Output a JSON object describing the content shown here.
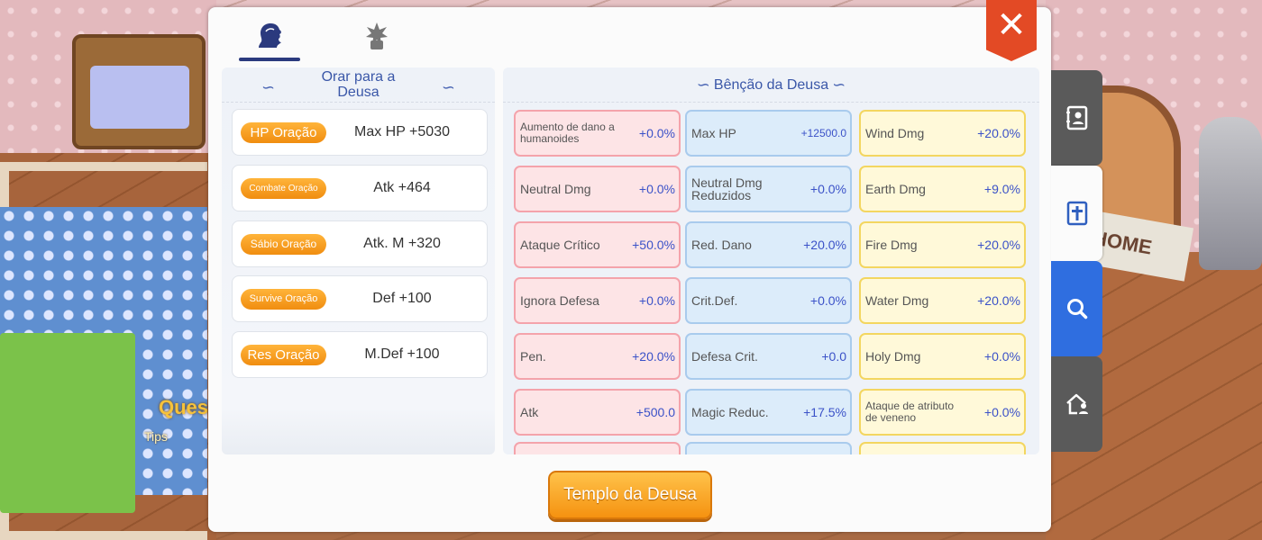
{
  "scene": {
    "quest_label": "Ques",
    "tips_label": "Tips",
    "home_sign": "HOME"
  },
  "tabs": [
    {
      "icon": "goddess-head-icon",
      "selected": true
    },
    {
      "icon": "emblem-icon",
      "selected": false
    }
  ],
  "close_icon": "close-icon",
  "close_glyph": "✕",
  "prayer_section": {
    "title": "Orar para a Deusa",
    "items": [
      {
        "button": "HP Oração",
        "value": "Max HP  +5030"
      },
      {
        "button": "Combate Oração",
        "value": "Atk +464"
      },
      {
        "button": "Sábio Oração",
        "value": "Atk. M +320"
      },
      {
        "button": "Survive Oração",
        "value": "Def +100"
      },
      {
        "button": "Res Oração",
        "value": "M.Def +100"
      }
    ]
  },
  "blessing_section": {
    "title": "Bênção da Deusa",
    "rows": [
      [
        {
          "label": "Aumento de dano a humanoides",
          "value": "+0.0%",
          "color": "pink"
        },
        {
          "label": "Max HP",
          "value": "+12500.0",
          "color": "blue"
        },
        {
          "label": "Wind Dmg",
          "value": "+20.0%",
          "color": "yellow"
        }
      ],
      [
        {
          "label": "Neutral Dmg",
          "value": "+0.0%",
          "color": "pink"
        },
        {
          "label": "Neutral Dmg Reduzidos",
          "value": "+0.0%",
          "color": "blue"
        },
        {
          "label": "Earth Dmg",
          "value": "+9.0%",
          "color": "yellow"
        }
      ],
      [
        {
          "label": "Ataque Crítico",
          "value": "+50.0%",
          "color": "pink"
        },
        {
          "label": "Red. Dano",
          "value": "+20.0%",
          "color": "blue"
        },
        {
          "label": "Fire Dmg",
          "value": "+20.0%",
          "color": "yellow"
        }
      ],
      [
        {
          "label": "Ignora Defesa",
          "value": "+0.0%",
          "color": "pink"
        },
        {
          "label": "Crit.Def.",
          "value": "+0.0%",
          "color": "blue"
        },
        {
          "label": "Water Dmg",
          "value": "+20.0%",
          "color": "yellow"
        }
      ],
      [
        {
          "label": "Pen.",
          "value": "+20.0%",
          "color": "pink"
        },
        {
          "label": "Defesa Crit.",
          "value": "+0.0",
          "color": "blue"
        },
        {
          "label": "Holy Dmg",
          "value": "+0.0%",
          "color": "yellow"
        }
      ],
      [
        {
          "label": "Atk",
          "value": "+500.0",
          "color": "pink"
        },
        {
          "label": "Magic Reduc.",
          "value": "+17.5%",
          "color": "blue"
        },
        {
          "label": "Ataque de atributo de veneno",
          "value": "+0.0%",
          "color": "yellow"
        }
      ]
    ]
  },
  "temple_button": "Templo da Deusa",
  "side_tabs": [
    {
      "icon": "contact-book-icon"
    },
    {
      "icon": "cross-book-icon",
      "selected": true
    },
    {
      "icon": "search-icon"
    },
    {
      "icon": "house-person-icon"
    }
  ],
  "colors": {
    "accent": "#2b3a7e",
    "orange": "#f59210",
    "close": "#e34a25",
    "value_blue": "#3b52c8"
  }
}
